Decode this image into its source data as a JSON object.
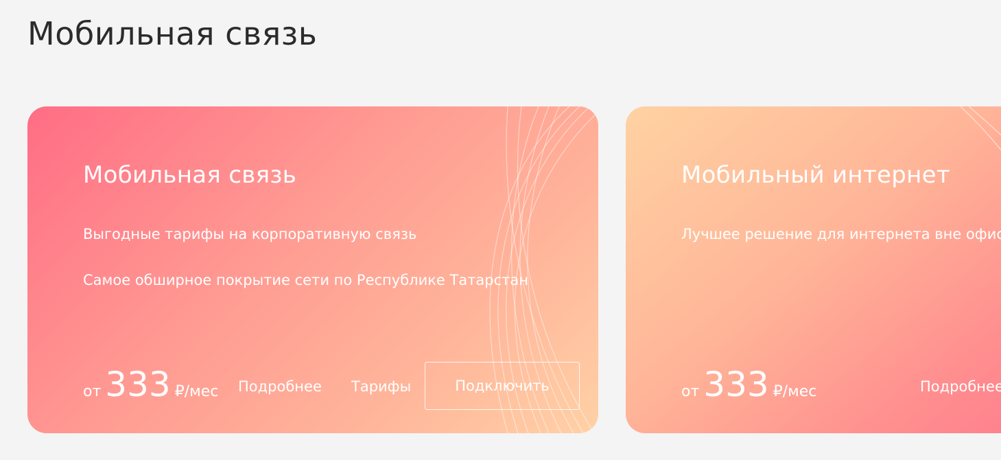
{
  "page": {
    "title": "Мобильная связь"
  },
  "cards": [
    {
      "title": "Мобильная связь",
      "lines": [
        "Выгодные тарифы на корпоративную связь",
        "Самое обширное покрытие сети по Республике Татарстан"
      ],
      "price": {
        "prefix": "от",
        "amount": "333",
        "unit": "₽/мес"
      },
      "actions": {
        "details_label": "Подробнее",
        "tariffs_label": "Тарифы",
        "connect_label": "Подключить"
      },
      "gradient_colors": [
        "#ff6d85",
        "#ff9a92",
        "#ffb49a",
        "#ffd1a6"
      ]
    },
    {
      "title": "Мобильный интернет",
      "lines": [
        "Лучшее решение для интернета вне офиса"
      ],
      "price": {
        "prefix": "от",
        "amount": "333",
        "unit": "₽/мес"
      },
      "actions": {
        "details_label": "Подробнее"
      },
      "gradient_colors": [
        "#ffd2a2",
        "#ffb598",
        "#ff8f8f",
        "#ff7e8d"
      ]
    }
  ],
  "colors": {
    "page_background": "#f4f4f4",
    "title_text": "#2b2b2b",
    "card_text": "#ffffff"
  }
}
